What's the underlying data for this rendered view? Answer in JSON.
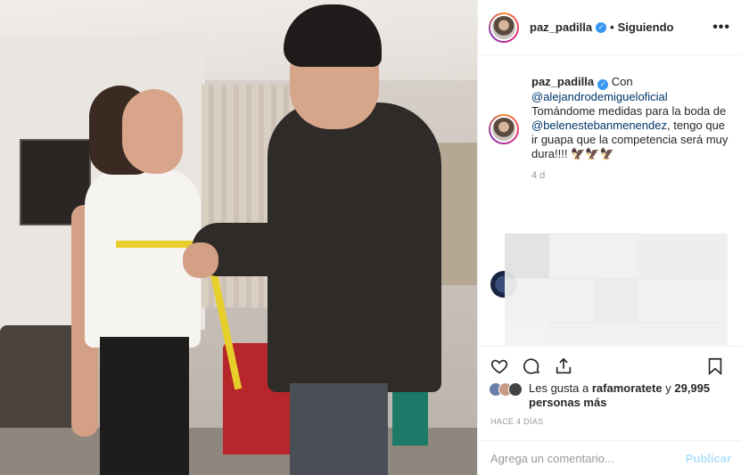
{
  "post": {
    "username": "paz_padilla",
    "verified_mark": "✓",
    "dot": "•",
    "follow_status": "Siguiendo",
    "more": "•••"
  },
  "caption": {
    "username": "paz_padilla",
    "text_1": "Con",
    "mention_1": "@alejandrodemigueloficial",
    "text_2": "Tomándome medidas para la boda de",
    "mention_2": "@belenestebanmenendez",
    "text_3": ", tengo que ir guapa que la competencia será muy dura!!!!",
    "emojis": "🦅🦅🦅"
  },
  "comment_time": "4 d",
  "likes": {
    "prefix": "Les gusta a",
    "user": "rafamoratete",
    "middle": "y",
    "count": "29,995 personas más"
  },
  "timestamp": "HACE 4 DÍAS",
  "comment_box": {
    "placeholder": "Agrega un comentario...",
    "publish_label": "Publicar"
  },
  "colors": {
    "accent_blue": "#3897f0",
    "publish_disabled": "#b2dffc",
    "mention": "#003569"
  },
  "icons": [
    "heart-icon",
    "comment-icon",
    "share-icon",
    "bookmark-icon",
    "more-icon",
    "verified-icon"
  ]
}
